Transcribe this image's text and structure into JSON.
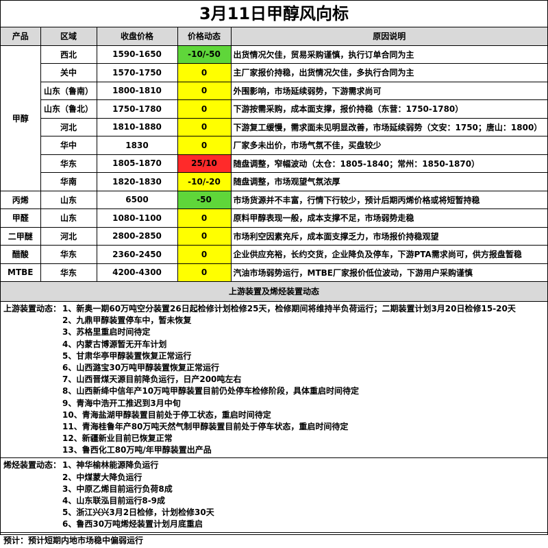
{
  "title": "3月11日甲醇风向标",
  "headers": [
    "产品",
    "区域",
    "收盘价格",
    "价格动态",
    "原因说明"
  ],
  "rows": [
    {
      "product": "甲醇",
      "region": "西北",
      "price": "1590-1650",
      "change": "-10/-50",
      "change_color": "#5fd63a",
      "reason": "出货情况欠佳，贸易采购谨慎，执行订单合同为主"
    },
    {
      "region": "关中",
      "price": "1570-1750",
      "change": "0",
      "change_color": "#ffff00",
      "reason": "主厂家报价持稳，出货情况欠佳，多执行合同为主"
    },
    {
      "region": "山东（鲁南）",
      "price": "1800-1810",
      "change": "0",
      "change_color": "#ffff00",
      "reason": "外围影响，市场延续弱势，下游需求尚可"
    },
    {
      "region": "山东（鲁北）",
      "price": "1750-1780",
      "change": "0",
      "change_color": "#ffff00",
      "reason": "下游按需采购，成本面支撑，报价持稳（东营：1750-1780）"
    },
    {
      "region": "河北",
      "price": "1810-1880",
      "change": "0",
      "change_color": "#ffff00",
      "reason": "下游复工缓慢，需求面未见明显改善，市场延续弱势（文安：1750；唐山：1800）"
    },
    {
      "region": "华中",
      "price": "1830",
      "change": "0",
      "change_color": "#ffff00",
      "reason": "厂家多未出价，市场气氛不佳，买盘较少"
    },
    {
      "region": "华东",
      "price": "1805-1870",
      "change": "25/10",
      "change_color": "#ff2a2a",
      "reason": "随盘调整，窄幅波动（太仓：1805-1840；常州：1850-1870）"
    },
    {
      "region": "华南",
      "price": "1820-1830",
      "change": "-10/-20",
      "change_color": "#ffff00",
      "reason": "随盘调整，市场观望气氛浓厚"
    },
    {
      "product": "丙烯",
      "region": "山东",
      "price": "6500",
      "change": "-50",
      "change_color": "#5fd63a",
      "reason": "市场货源并不丰富，行情下行较少，预计后期丙烯价格或将短暂持稳"
    },
    {
      "product": "甲醛",
      "region": "山东",
      "price": "1080-1100",
      "change": "0",
      "change_color": "#ffff00",
      "reason": "原料甲醇表现一般，成本支撑不足，市场弱势走稳"
    },
    {
      "product": "二甲醚",
      "region": "河北",
      "price": "2800-2850",
      "change": "0",
      "change_color": "#ffff00",
      "reason": "市场利空因素充斥，成本面支撑乏力，市场报价持稳观望"
    },
    {
      "product": "醋酸",
      "region": "华东",
      "price": "2360-2450",
      "change": "0",
      "change_color": "#ffff00",
      "reason": "企业供应充裕，长约交货，企业降负及停车，下游PTA需求尚可，供方报盘暂稳"
    },
    {
      "product": "MTBE",
      "region": "华东",
      "price": "4200-4300",
      "change": "0",
      "change_color": "#ffff00",
      "reason": "汽油市场弱势运行，MTBE厂家报价低位波动，下游用户采购谨慎"
    }
  ],
  "section_title": "上游装置及烯烃装置动态",
  "upstream": {
    "label": "上游装置动态：",
    "items": [
      "1、新奥一期60万吨空分装置26日起检修计划检修25天，检修期间将维持半负荷运行；二期装置计划3月20日检修15-20天",
      "2、九鼎甲醇装置停车中，暂未恢复",
      "3、苏格里重启时间待定",
      "4、内蒙古博源暂无开车计划",
      "5、甘肃华亭甲醇装置恢复正常运行",
      "6、山西潞宝30万吨甲醇装置恢复正常运行",
      "7、山西晋煤天源目前降负运行，日产200吨左右",
      "8、山西新绛中信年产10万吨甲醇装置目前仍处停车检修阶段，具体重启时间待定",
      "9、青海中浩开工推迟到3月中旬",
      "10、青海盐湖甲醇装置目前处于停工状态，重启时间待定",
      "11、青海桂鲁年产80万吨天然气制甲醇装置目前处于停车状态，重启时间待定",
      "12、新疆新业目前已恢复正常",
      "13、鲁西化工80万吨/年甲醇装置出产品"
    ]
  },
  "olefin": {
    "label": "烯烃装置动态：",
    "items": [
      "1、神华榆林能源降负运行",
      "2、中煤蒙大降负运行",
      "3、中原乙烯目前运行负荷8成",
      "4、山东联泓目前运行8-9成",
      "5、浙江兴兴3月2日检修，计划检修30天",
      "6、鲁西30万吨烯烃装置计划月底重启"
    ]
  },
  "forecast": "预计：预计短期内地市场稳中偏弱运行"
}
